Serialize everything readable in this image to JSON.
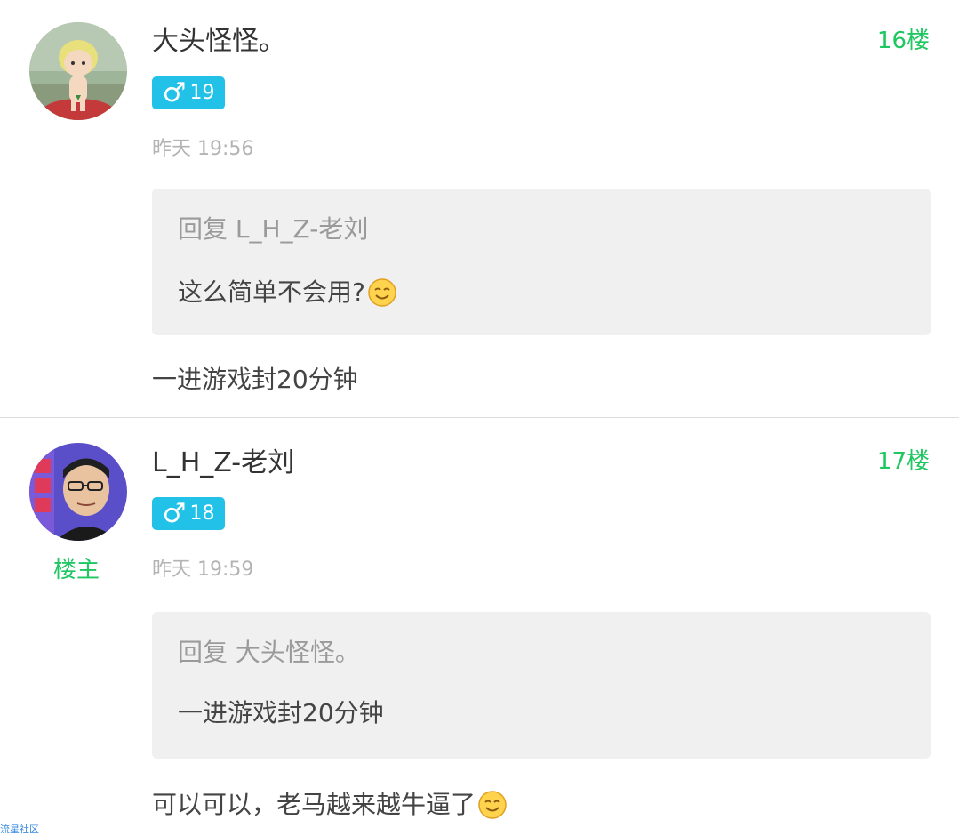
{
  "posts": [
    {
      "username": "大头怪怪。",
      "floor": "16楼",
      "gender_symbol": "♂",
      "age": "19",
      "time": "昨天 19:56",
      "quote_header": "回复 L_H_Z-老刘",
      "quote_text": "这么简单不会用?",
      "quote_emoji": "smile-emoji",
      "body": "一进游戏封20分钟",
      "is_op": false
    },
    {
      "username": "L_H_Z-老刘",
      "floor": "17楼",
      "gender_symbol": "♂",
      "age": "18",
      "time": "昨天 19:59",
      "op_label": "楼主",
      "quote_header": "回复 大头怪怪。",
      "quote_text": "一进游戏封20分钟",
      "body": "可以可以，老马越来越牛逼了",
      "body_emoji": "smile-emoji",
      "is_op": true
    }
  ],
  "watermark": "流星社区",
  "colors": {
    "accent_green": "#1ec761",
    "badge_blue": "#22c1e8",
    "quote_bg": "#f0f0f0",
    "muted_text": "#b3b3b3"
  }
}
